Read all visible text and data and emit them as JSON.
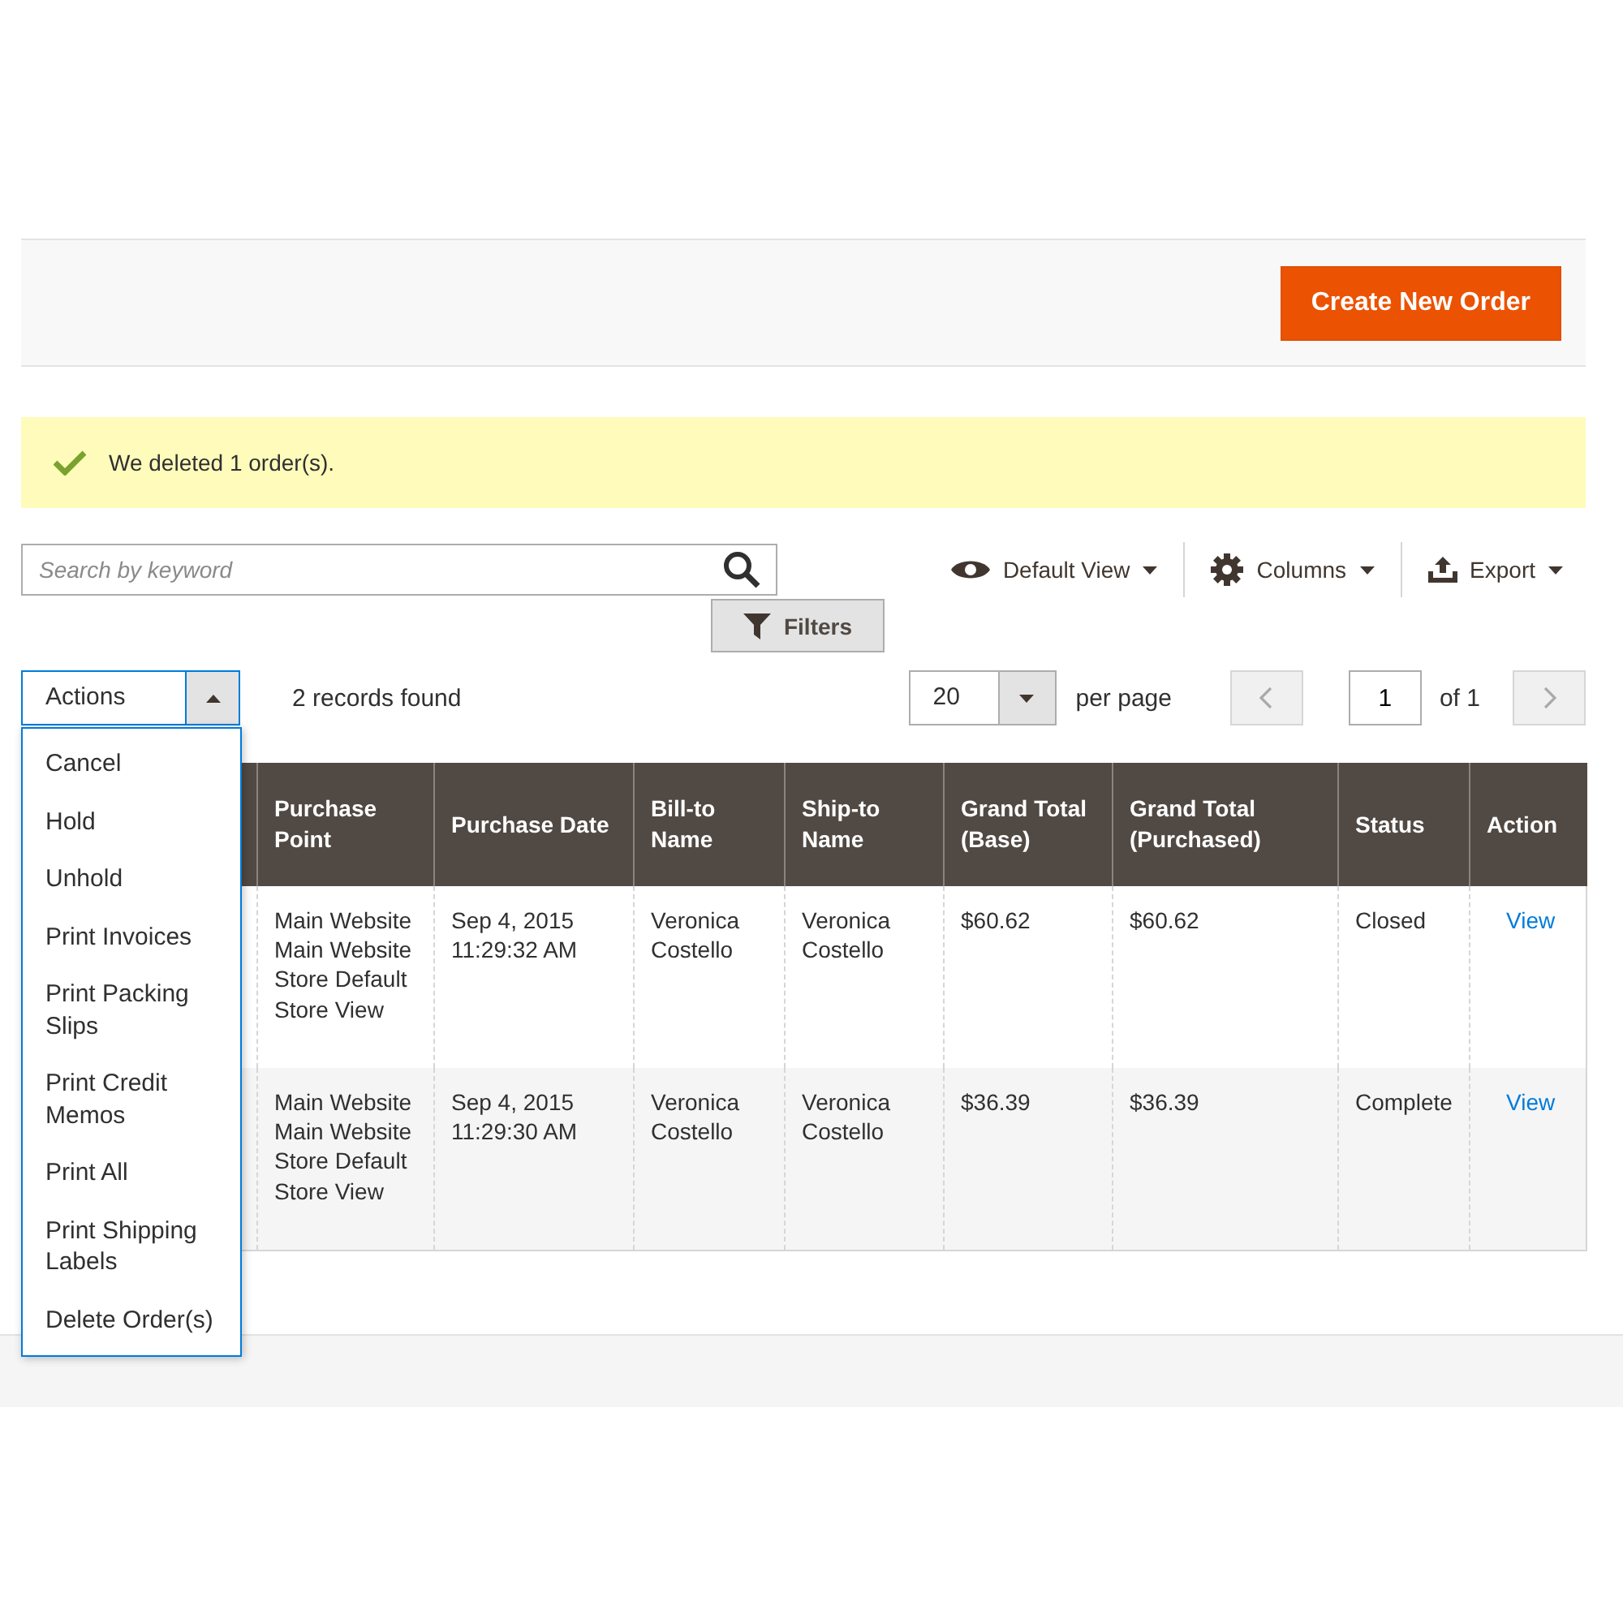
{
  "page_actions": {
    "primary_button": "Create New Order"
  },
  "message": {
    "kind": "success",
    "text": "We deleted 1 order(s)."
  },
  "search": {
    "placeholder": "Search by keyword"
  },
  "toolbar": {
    "view": "Default View",
    "columns": "Columns",
    "export": "Export",
    "filters": "Filters"
  },
  "actions": {
    "label": "Actions",
    "expanded": true,
    "items": [
      "Cancel",
      "Hold",
      "Unhold",
      "Print Invoices",
      "Print Packing Slips",
      "Print Credit Memos",
      "Print All",
      "Print Shipping Labels",
      "Delete Order(s)"
    ]
  },
  "records": "2 records found",
  "pagination": {
    "per_page": "20",
    "per_page_label": "per page",
    "page": "1",
    "of": "of 1"
  },
  "table": {
    "columns": [
      "",
      "Purchase Point",
      "Purchase Date",
      "Bill-to Name",
      "Ship-to Name",
      "Grand Total (Base)",
      "Grand Total (Purchased)",
      "Status",
      "Action"
    ],
    "rows": [
      {
        "cells": [
          "",
          "Main Website Main Website Store Default Store View",
          "Sep 4, 2015 11:29:32 AM",
          "Veronica Costello",
          "Veronica Costello",
          "$60.62",
          "$60.62",
          "Closed"
        ],
        "link": "View"
      },
      {
        "cells": [
          "",
          "Main Website Main Website Store Default Store View",
          "Sep 4, 2015 11:29:30 AM",
          "Veronica Costello",
          "Veronica Costello",
          "$36.39",
          "$36.39",
          "Complete"
        ],
        "link": "View"
      }
    ]
  }
}
